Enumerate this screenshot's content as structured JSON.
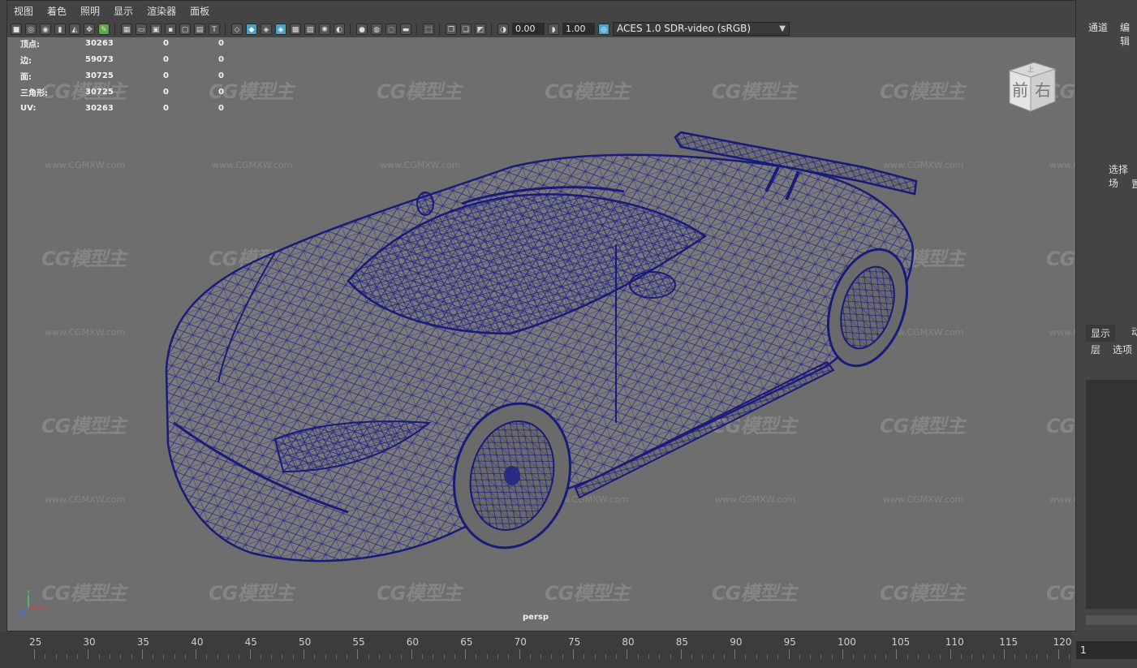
{
  "menu": [
    "视图",
    "着色",
    "照明",
    "显示",
    "渲染器",
    "面板"
  ],
  "toolbar": {
    "exposure": "0.00",
    "gamma": "1.00",
    "color_space": "ACES 1.0 SDR-video (sRGB)"
  },
  "hud": [
    {
      "label": "顶点:",
      "v1": "30263",
      "v2": "0",
      "v3": "0"
    },
    {
      "label": "边:",
      "v1": "59073",
      "v2": "0",
      "v3": "0"
    },
    {
      "label": "面:",
      "v1": "30725",
      "v2": "0",
      "v3": "0"
    },
    {
      "label": "三角形:",
      "v1": "30725",
      "v2": "0",
      "v3": "0"
    },
    {
      "label": "UV:",
      "v1": "30263",
      "v2": "0",
      "v3": "0"
    }
  ],
  "viewcube": {
    "front": "前",
    "right": "右",
    "top": "上"
  },
  "camera_label": "persp",
  "axis": {
    "y": "Y",
    "x": "X",
    "z": "Z"
  },
  "watermark": {
    "logo": "CG模型主",
    "url": "www.CGMXW.com"
  },
  "timeline": {
    "ticks": [
      "25",
      "30",
      "35",
      "40",
      "45",
      "50",
      "55",
      "60",
      "65",
      "70",
      "75",
      "80",
      "85",
      "90",
      "95",
      "100",
      "105",
      "110",
      "115",
      "120"
    ],
    "current_frame": "1"
  },
  "right_panel": {
    "tab_channels": "通道",
    "tab_edit": "编辑",
    "hint": "选择场",
    "hint2": "置",
    "tab_display": "显示",
    "tab_other": "动",
    "layers": "层",
    "options": "选项"
  },
  "colors": {
    "wire": "#1a1a7a",
    "viewport": "#6e6e6e",
    "accent": "#4aa3c7"
  }
}
